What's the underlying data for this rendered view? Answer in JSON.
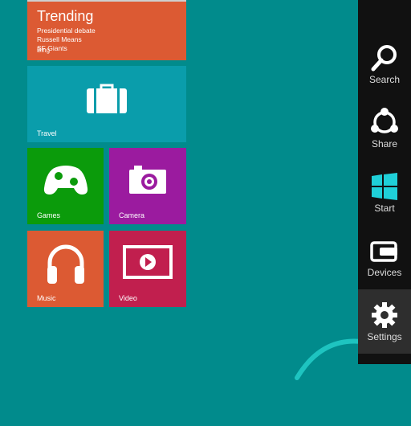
{
  "tiles": {
    "bing": {
      "title": "Trending",
      "items": [
        "Presidential debate",
        "Russell Means",
        "SF Giants"
      ],
      "brand": "Bing"
    },
    "travel": {
      "label": "Travel"
    },
    "games": {
      "label": "Games"
    },
    "camera": {
      "label": "Camera"
    },
    "music": {
      "label": "Music"
    },
    "video": {
      "label": "Video"
    }
  },
  "charms": [
    {
      "label": "Search",
      "icon": "search-icon"
    },
    {
      "label": "Share",
      "icon": "share-icon"
    },
    {
      "label": "Start",
      "icon": "windows-logo-icon"
    },
    {
      "label": "Devices",
      "icon": "devices-icon"
    },
    {
      "label": "Settings",
      "icon": "settings-icon",
      "selected": true
    }
  ],
  "colors": {
    "background": "#018b8c",
    "charm_bar": "#111111",
    "bing_tile": "#dc5a33",
    "travel_tile": "#0a9dab",
    "games_tile": "#0b9b0b",
    "camera_tile": "#9b1b9f",
    "music_tile": "#dc5a33",
    "video_tile": "#c11f4e",
    "start_accent": "#1fd0d8"
  }
}
